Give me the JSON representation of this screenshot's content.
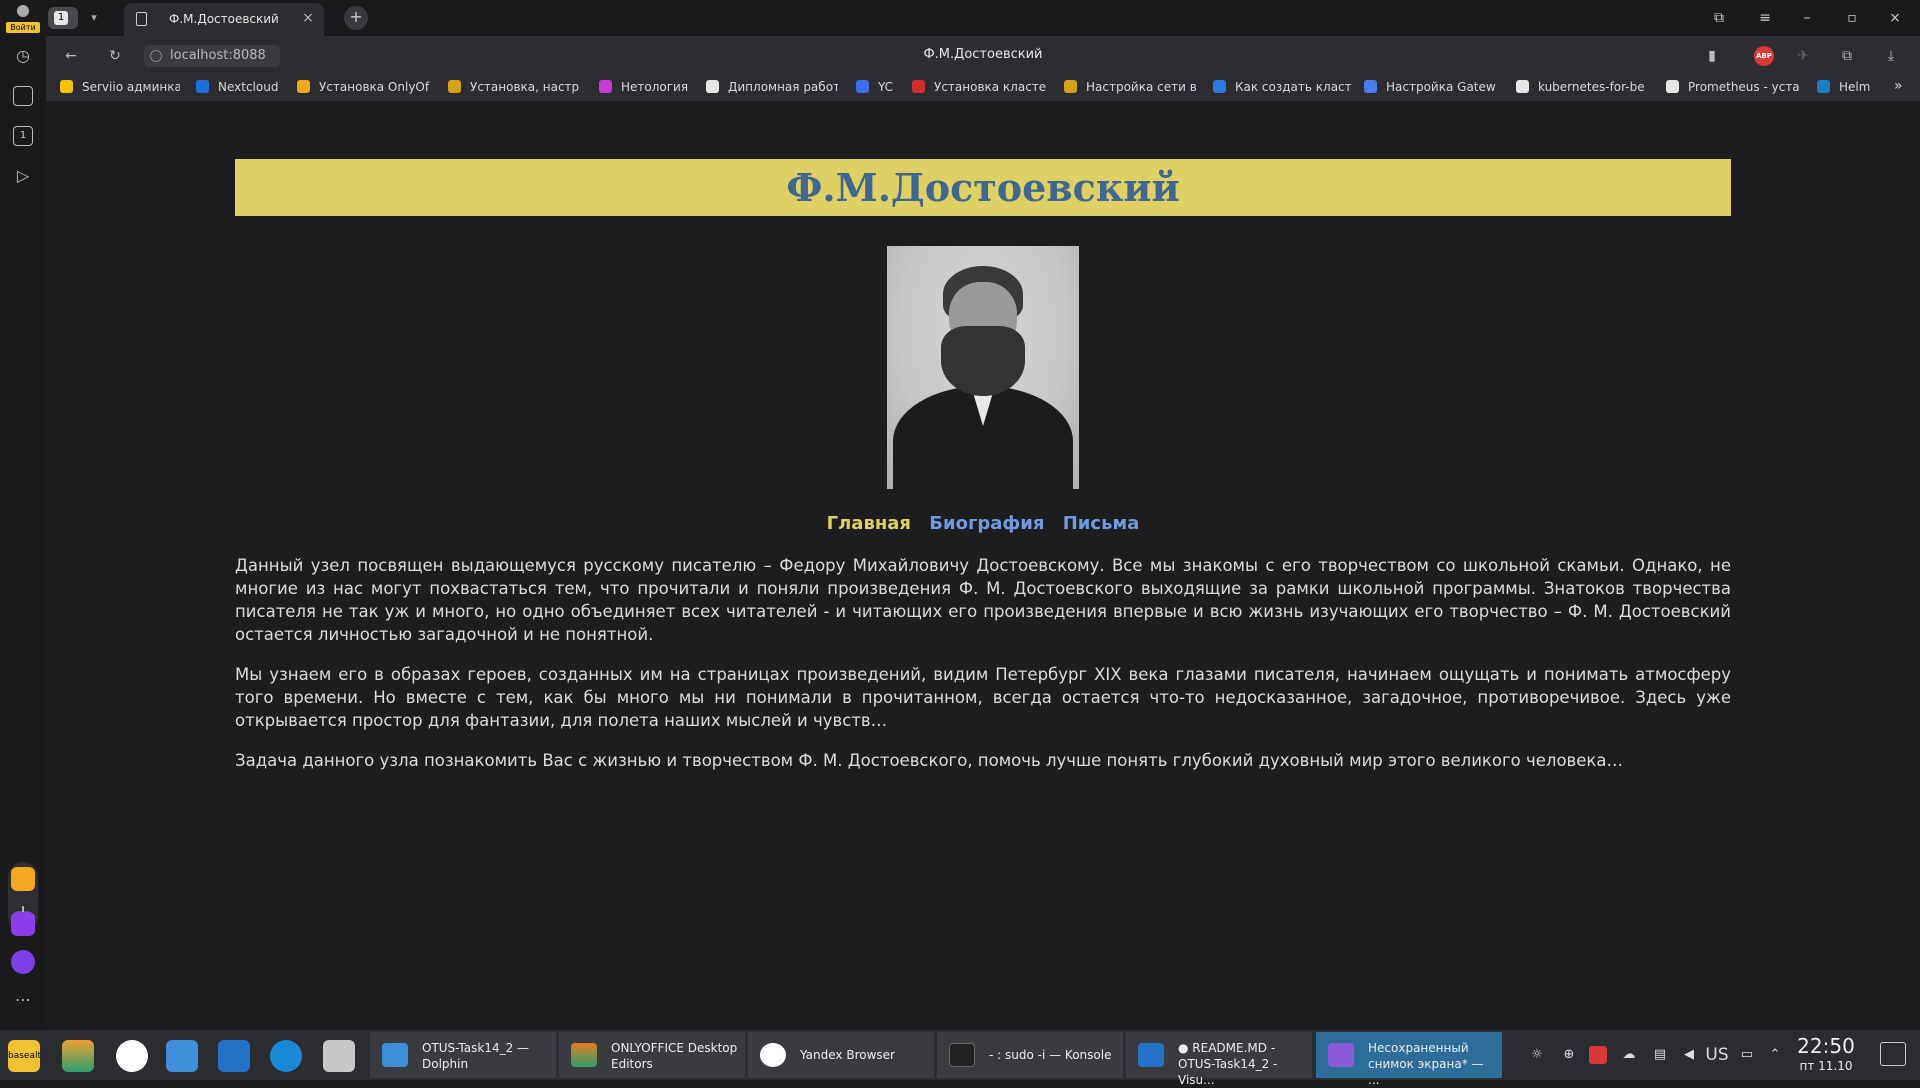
{
  "browser": {
    "login_label": "Войти",
    "tab_count": "1",
    "active_tab_title": "Ф.М.Достоевский",
    "address": "localhost:8088",
    "page_title": "Ф.М.Достоевский",
    "adblock_label": "ABP"
  },
  "bookmarks": [
    {
      "label": "Serviio админка",
      "color": "#f5c400"
    },
    {
      "label": "Nextcloud",
      "color": "#1e6fd9"
    },
    {
      "label": "Установка OnlyOf",
      "color": "#f2a91b"
    },
    {
      "label": "Установка, настр",
      "color": "#d4a017"
    },
    {
      "label": "Нетология",
      "color": "#c83ad8"
    },
    {
      "label": "Дипломная работ",
      "color": "#e6e6e6"
    },
    {
      "label": "YC",
      "color": "#3b6ee8"
    },
    {
      "label": "Установка класте",
      "color": "#d12e2e"
    },
    {
      "label": "Настройка сети в",
      "color": "#d4a017"
    },
    {
      "label": "Как создать класт",
      "color": "#2d7be0"
    },
    {
      "label": "Настройка Gatew",
      "color": "#4a7cf0"
    },
    {
      "label": "kubernetes-for-be",
      "color": "#e6e6e6"
    },
    {
      "label": "Prometheus - уста",
      "color": "#e6e6e6"
    },
    {
      "label": "Helm",
      "color": "#1b7fbf"
    }
  ],
  "page": {
    "heading": "Ф.М.Достоевский",
    "nav": [
      "Главная",
      "Биография",
      "Письма"
    ],
    "paragraphs": [
      "Данный узел посвящен выдающемуся русскому писателю – Федору Михайловичу Достоевскому. Все мы знакомы с его творчеством со школьной скамьи. Однако, не многие из нас могут похвастаться тем, что прочитали и поняли произведения Ф. М. Достоевского выходящие за рамки школьной программы. Знатоков творчества писателя не так уж и много, но одно объединяет всех читателей - и читающих его произведения впервые и всю жизнь изучающих его творчество – Ф. М. Достоевский остается личностью загадочной и не понятной.",
      "Мы узнаем его в образах героев, созданных им на страницах произведений, видим Петербург XIX века глазами писателя, начинаем ощущать и понимать атмосферу того времени. Но вместе с тем, как бы много мы ни понимали в прочитанном, всегда остается что-то недосказанное, загадочное, противоречивое. Здесь уже открывается простор для фантазии, для полета наших мыслей и чувств…",
      "Задача данного узла познакомить Вас с жизнью и творчеством Ф. М. Достоевского, помочь лучше понять глубокий духовный мир этого великого человека…"
    ]
  },
  "taskbar": {
    "start_label": "basealt",
    "tasks": [
      {
        "line1": "OTUS-Task14_2 —",
        "line2": "Dolphin",
        "color": "#3d8fd8"
      },
      {
        "line1": "ONLYOFFICE Desktop",
        "line2": "Editors",
        "color": "#e87d1e"
      },
      {
        "line1": "Yandex Browser",
        "line2": "",
        "color": "#e23a2f"
      },
      {
        "line1": "- : sudo -i — Konsole",
        "line2": "",
        "color": "#2a2a2a"
      },
      {
        "line1": "● README.MD -",
        "line2": "OTUS-Task14_2 - Visu...",
        "color": "#2472c8"
      },
      {
        "line1": "Несохраненный",
        "line2": "снимок экрана* — ...",
        "color": "#8a5ad8"
      }
    ],
    "keyboard_layout": "US",
    "time": "22:50",
    "date": "пт 11.10"
  }
}
